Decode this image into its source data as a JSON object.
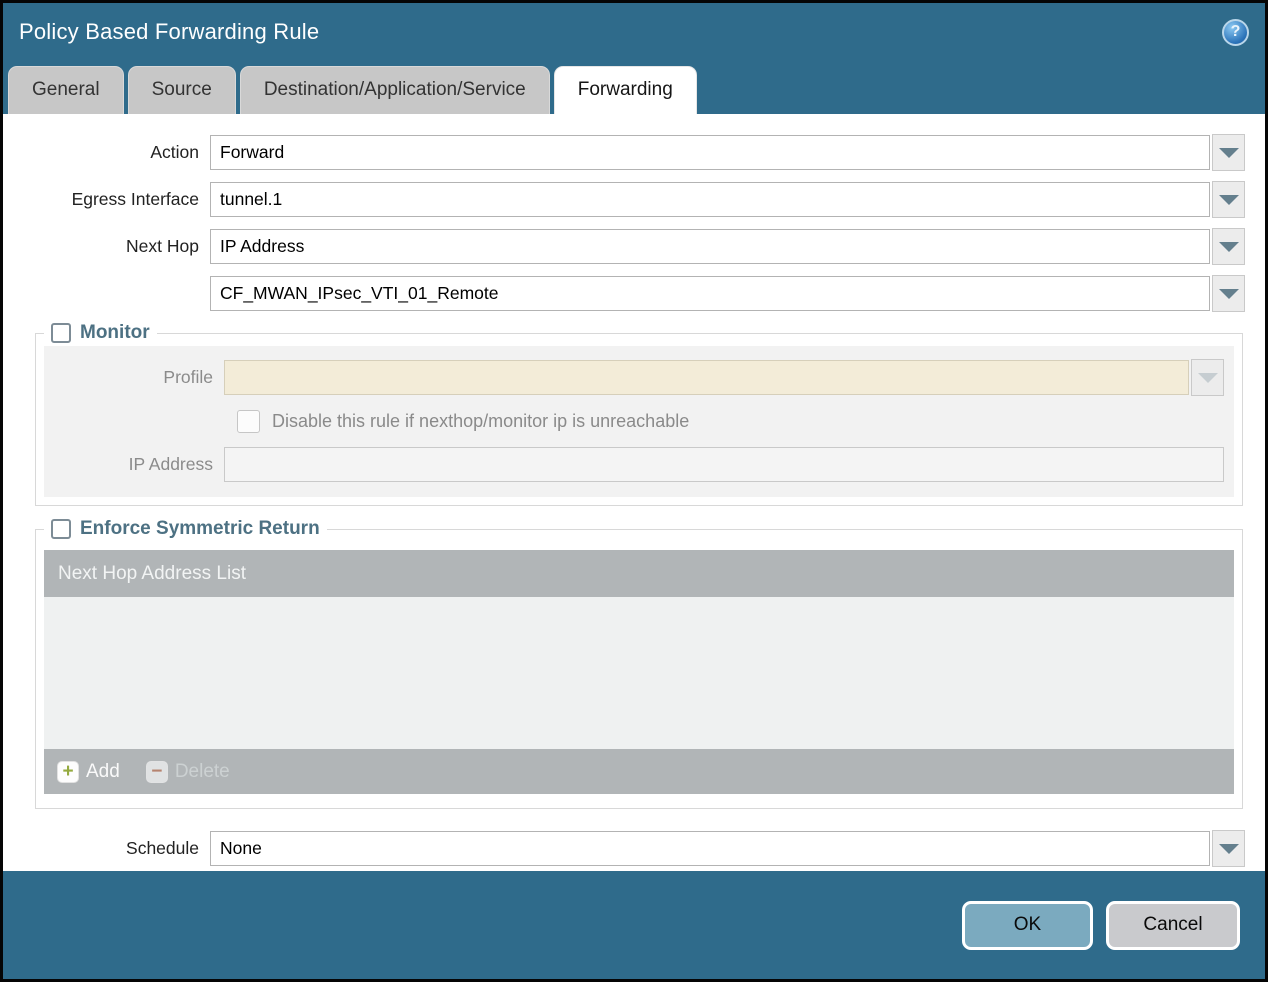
{
  "window": {
    "title": "Policy Based Forwarding Rule",
    "help_icon": "?"
  },
  "tabs": [
    {
      "label": "General",
      "active": false
    },
    {
      "label": "Source",
      "active": false
    },
    {
      "label": "Destination/Application/Service",
      "active": false
    },
    {
      "label": "Forwarding",
      "active": true
    }
  ],
  "form": {
    "action": {
      "label": "Action",
      "value": "Forward"
    },
    "egress_interface": {
      "label": "Egress Interface",
      "value": "tunnel.1"
    },
    "next_hop": {
      "label": "Next Hop",
      "value": "IP Address"
    },
    "next_hop_address": {
      "value": "CF_MWAN_IPsec_VTI_01_Remote"
    },
    "schedule": {
      "label": "Schedule",
      "value": "None"
    }
  },
  "monitor": {
    "title": "Monitor",
    "checked": false,
    "profile": {
      "label": "Profile",
      "value": ""
    },
    "disable_rule": {
      "label": "Disable this rule if nexthop/monitor ip is unreachable",
      "checked": false
    },
    "ip_address": {
      "label": "IP Address",
      "value": ""
    }
  },
  "enforce_symmetric_return": {
    "title": "Enforce Symmetric Return",
    "checked": false,
    "list": {
      "header": "Next Hop Address List",
      "rows": []
    },
    "add_button": "Add",
    "delete_button": "Delete"
  },
  "buttons": {
    "ok": "OK",
    "cancel": "Cancel"
  },
  "colors": {
    "chrome_teal": "#2f6b8b",
    "tab_inactive": "#c7c7c7",
    "ok_button": "#7baabf",
    "cancel_button": "#c9cacd",
    "disabled_field_beige": "#f3ecd8",
    "grid_chrome": "#b1b5b7",
    "section_title": "#4d7183",
    "add_icon_green": "#94aa3f",
    "delete_icon_red": "#b5836f"
  }
}
